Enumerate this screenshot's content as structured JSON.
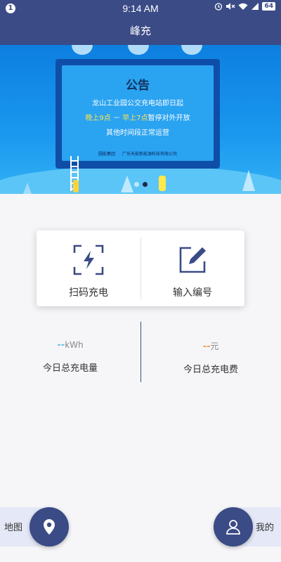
{
  "status_bar": {
    "notification_count": "1",
    "time": "9:14 AM",
    "battery": "64",
    "icons": [
      "alarm-icon",
      "mute-icon",
      "wifi-icon",
      "signal-icon",
      "battery-icon"
    ]
  },
  "header": {
    "title": "峰充"
  },
  "banner": {
    "notice_title": "公告",
    "line1": "龙山工业园公交充电站即日起",
    "line2_highlight_a": "晚上9点",
    "line2_separator": " － ",
    "line2_highlight_b": "早上7点",
    "line2_rest": "暂停对外开放",
    "line3": "其他时间段正常运营",
    "footer_left": "圆能集团",
    "footer_right": "广东天能新能源科技有限公司",
    "carousel_pages": 2,
    "carousel_active": 1
  },
  "actions": {
    "scan": {
      "label": "扫码充电",
      "icon": "scan-charge-icon"
    },
    "input": {
      "label": "输入编号",
      "icon": "edit-icon"
    }
  },
  "stats": {
    "energy": {
      "value": "--",
      "unit": "kWh",
      "label": "今日总充电量"
    },
    "cost": {
      "value": "--",
      "unit": "元",
      "label": "今日总充电费"
    }
  },
  "bottom_nav": {
    "map_label": "地图",
    "me_label": "我的"
  },
  "colors": {
    "primary": "#3a4b86",
    "energy_accent": "#6cc0e8",
    "cost_accent": "#f0a048"
  }
}
